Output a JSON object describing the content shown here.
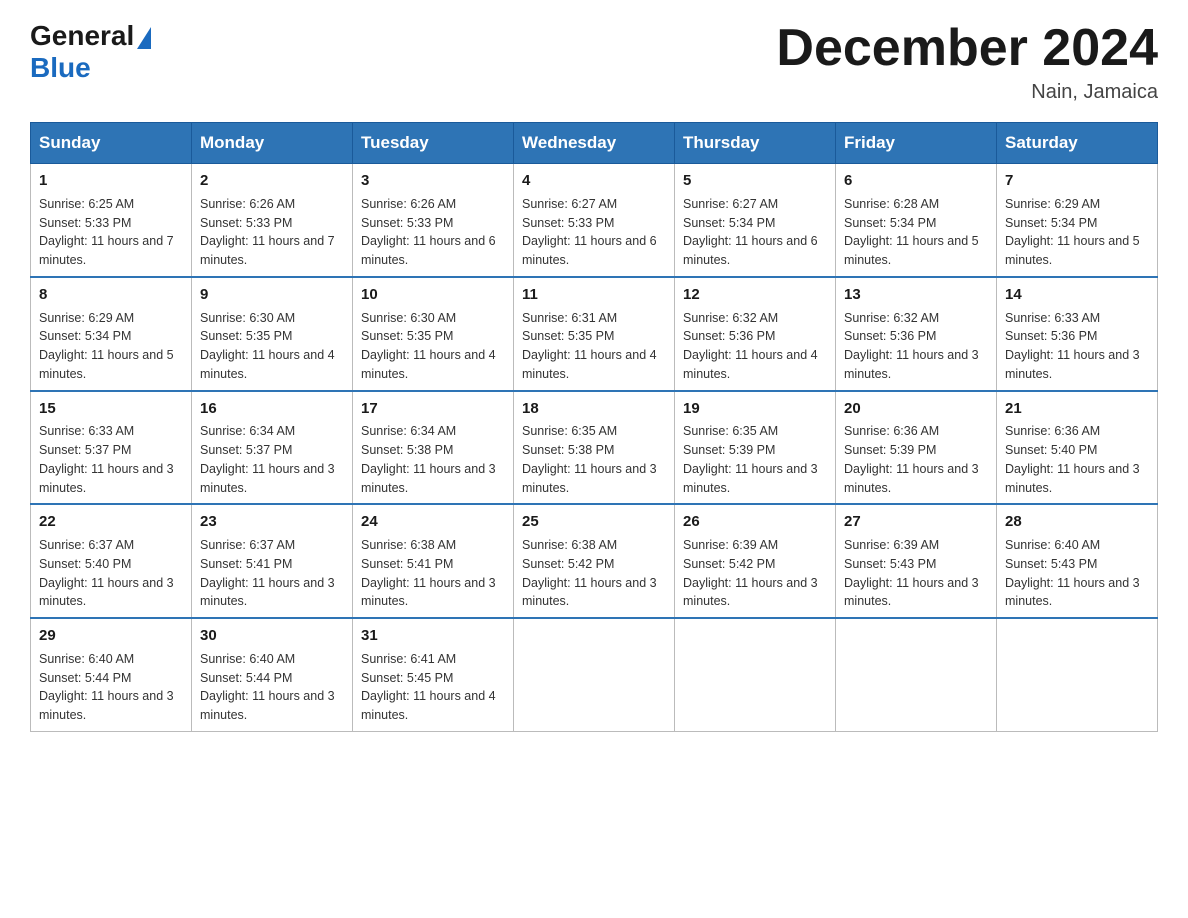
{
  "header": {
    "logo_general": "General",
    "logo_blue": "Blue",
    "title": "December 2024",
    "location": "Nain, Jamaica"
  },
  "calendar": {
    "days_of_week": [
      "Sunday",
      "Monday",
      "Tuesday",
      "Wednesday",
      "Thursday",
      "Friday",
      "Saturday"
    ],
    "weeks": [
      [
        {
          "day": "1",
          "sunrise": "6:25 AM",
          "sunset": "5:33 PM",
          "daylight": "11 hours and 7 minutes."
        },
        {
          "day": "2",
          "sunrise": "6:26 AM",
          "sunset": "5:33 PM",
          "daylight": "11 hours and 7 minutes."
        },
        {
          "day": "3",
          "sunrise": "6:26 AM",
          "sunset": "5:33 PM",
          "daylight": "11 hours and 6 minutes."
        },
        {
          "day": "4",
          "sunrise": "6:27 AM",
          "sunset": "5:33 PM",
          "daylight": "11 hours and 6 minutes."
        },
        {
          "day": "5",
          "sunrise": "6:27 AM",
          "sunset": "5:34 PM",
          "daylight": "11 hours and 6 minutes."
        },
        {
          "day": "6",
          "sunrise": "6:28 AM",
          "sunset": "5:34 PM",
          "daylight": "11 hours and 5 minutes."
        },
        {
          "day": "7",
          "sunrise": "6:29 AM",
          "sunset": "5:34 PM",
          "daylight": "11 hours and 5 minutes."
        }
      ],
      [
        {
          "day": "8",
          "sunrise": "6:29 AM",
          "sunset": "5:34 PM",
          "daylight": "11 hours and 5 minutes."
        },
        {
          "day": "9",
          "sunrise": "6:30 AM",
          "sunset": "5:35 PM",
          "daylight": "11 hours and 4 minutes."
        },
        {
          "day": "10",
          "sunrise": "6:30 AM",
          "sunset": "5:35 PM",
          "daylight": "11 hours and 4 minutes."
        },
        {
          "day": "11",
          "sunrise": "6:31 AM",
          "sunset": "5:35 PM",
          "daylight": "11 hours and 4 minutes."
        },
        {
          "day": "12",
          "sunrise": "6:32 AM",
          "sunset": "5:36 PM",
          "daylight": "11 hours and 4 minutes."
        },
        {
          "day": "13",
          "sunrise": "6:32 AM",
          "sunset": "5:36 PM",
          "daylight": "11 hours and 3 minutes."
        },
        {
          "day": "14",
          "sunrise": "6:33 AM",
          "sunset": "5:36 PM",
          "daylight": "11 hours and 3 minutes."
        }
      ],
      [
        {
          "day": "15",
          "sunrise": "6:33 AM",
          "sunset": "5:37 PM",
          "daylight": "11 hours and 3 minutes."
        },
        {
          "day": "16",
          "sunrise": "6:34 AM",
          "sunset": "5:37 PM",
          "daylight": "11 hours and 3 minutes."
        },
        {
          "day": "17",
          "sunrise": "6:34 AM",
          "sunset": "5:38 PM",
          "daylight": "11 hours and 3 minutes."
        },
        {
          "day": "18",
          "sunrise": "6:35 AM",
          "sunset": "5:38 PM",
          "daylight": "11 hours and 3 minutes."
        },
        {
          "day": "19",
          "sunrise": "6:35 AM",
          "sunset": "5:39 PM",
          "daylight": "11 hours and 3 minutes."
        },
        {
          "day": "20",
          "sunrise": "6:36 AM",
          "sunset": "5:39 PM",
          "daylight": "11 hours and 3 minutes."
        },
        {
          "day": "21",
          "sunrise": "6:36 AM",
          "sunset": "5:40 PM",
          "daylight": "11 hours and 3 minutes."
        }
      ],
      [
        {
          "day": "22",
          "sunrise": "6:37 AM",
          "sunset": "5:40 PM",
          "daylight": "11 hours and 3 minutes."
        },
        {
          "day": "23",
          "sunrise": "6:37 AM",
          "sunset": "5:41 PM",
          "daylight": "11 hours and 3 minutes."
        },
        {
          "day": "24",
          "sunrise": "6:38 AM",
          "sunset": "5:41 PM",
          "daylight": "11 hours and 3 minutes."
        },
        {
          "day": "25",
          "sunrise": "6:38 AM",
          "sunset": "5:42 PM",
          "daylight": "11 hours and 3 minutes."
        },
        {
          "day": "26",
          "sunrise": "6:39 AM",
          "sunset": "5:42 PM",
          "daylight": "11 hours and 3 minutes."
        },
        {
          "day": "27",
          "sunrise": "6:39 AM",
          "sunset": "5:43 PM",
          "daylight": "11 hours and 3 minutes."
        },
        {
          "day": "28",
          "sunrise": "6:40 AM",
          "sunset": "5:43 PM",
          "daylight": "11 hours and 3 minutes."
        }
      ],
      [
        {
          "day": "29",
          "sunrise": "6:40 AM",
          "sunset": "5:44 PM",
          "daylight": "11 hours and 3 minutes."
        },
        {
          "day": "30",
          "sunrise": "6:40 AM",
          "sunset": "5:44 PM",
          "daylight": "11 hours and 3 minutes."
        },
        {
          "day": "31",
          "sunrise": "6:41 AM",
          "sunset": "5:45 PM",
          "daylight": "11 hours and 4 minutes."
        },
        {
          "day": "",
          "sunrise": "",
          "sunset": "",
          "daylight": ""
        },
        {
          "day": "",
          "sunrise": "",
          "sunset": "",
          "daylight": ""
        },
        {
          "day": "",
          "sunrise": "",
          "sunset": "",
          "daylight": ""
        },
        {
          "day": "",
          "sunrise": "",
          "sunset": "",
          "daylight": ""
        }
      ]
    ]
  }
}
